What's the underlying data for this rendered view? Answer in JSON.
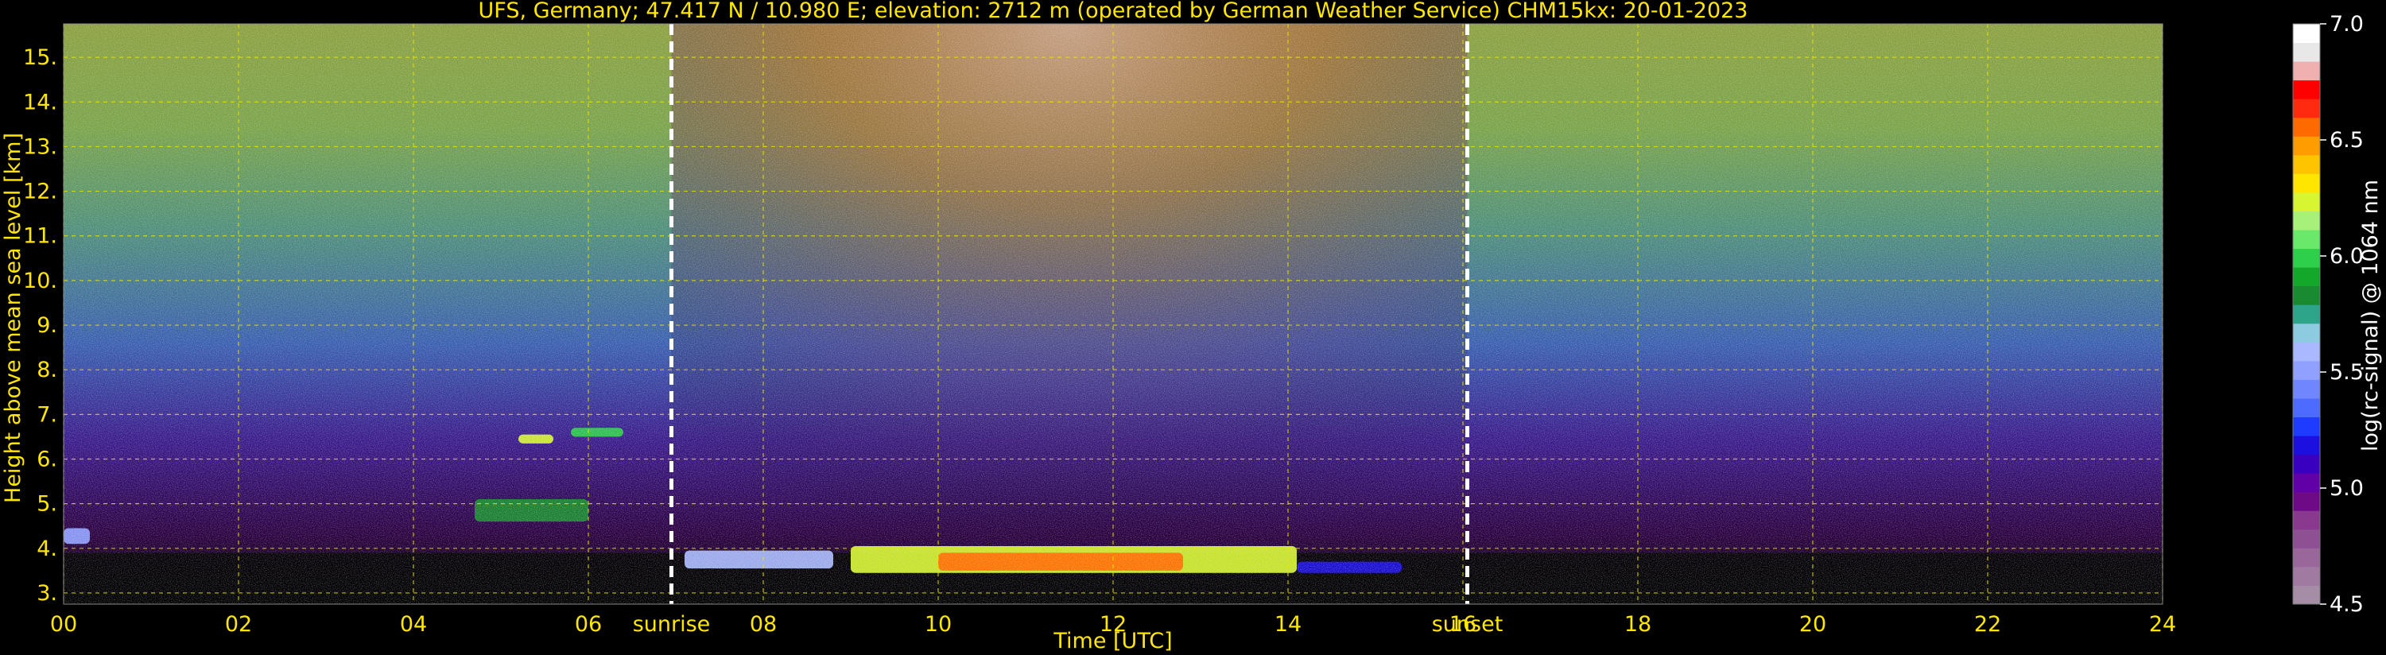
{
  "chart_data": {
    "type": "heatmap",
    "title": "UFS, Germany; 47.417 N / 10.980 E; elevation: 2712 m  (operated by German Weather Service)    CHM15kx: 20-01-2023",
    "xlabel": "Time [UTC]",
    "ylabel": "Height above mean sea level [km]",
    "xlim": [
      0,
      24
    ],
    "ylim": [
      2.75,
      15.75
    ],
    "xticks": [
      "00",
      "02",
      "04",
      "06",
      "08",
      "10",
      "12",
      "14",
      "16",
      "18",
      "20",
      "22",
      "24"
    ],
    "yticks": [
      "3.",
      "4.",
      "5.",
      "6.",
      "7.",
      "8.",
      "9.",
      "10.",
      "11.",
      "12.",
      "13.",
      "14.",
      "15."
    ],
    "grid": true,
    "events": [
      {
        "label": "sunrise",
        "x": 6.95
      },
      {
        "label": "sunset",
        "x": 16.05
      }
    ],
    "colorbar": {
      "label": "log(rc-signal) @ 1064 nm",
      "range": [
        4.5,
        7.0
      ],
      "ticks": [
        "4.5",
        "5.0",
        "5.5",
        "6.0",
        "6.5",
        "7.0"
      ],
      "colors": [
        "#a58ea5",
        "#a17aa1",
        "#9a679a",
        "#8f4f93",
        "#8a3a8e",
        "#6e0a85",
        "#6200a8",
        "#3a00c0",
        "#1c10e0",
        "#1e3cff",
        "#4d6bff",
        "#6f86ff",
        "#8fa0ff",
        "#a9b8ff",
        "#8ccbe0",
        "#2ea58a",
        "#1a8a30",
        "#14a82a",
        "#2ecf4a",
        "#69e86a",
        "#a7f07a",
        "#d7f531",
        "#ffe600",
        "#ffc400",
        "#ff9c00",
        "#ff6a00",
        "#ff2a10",
        "#ff0000",
        "#f0b0b0",
        "#e8e8e8",
        "#ffffff"
      ]
    },
    "cloud_layers": [
      {
        "t_start": 7.1,
        "t_end": 8.8,
        "h_bottom": 3.55,
        "h_top": 3.95,
        "level": 5.6
      },
      {
        "t_start": 9.0,
        "t_end": 14.1,
        "h_bottom": 3.45,
        "h_top": 4.05,
        "level": 6.25
      },
      {
        "t_start": 10.0,
        "t_end": 12.8,
        "h_bottom": 3.5,
        "h_top": 3.9,
        "level": 6.55
      },
      {
        "t_start": 14.1,
        "t_end": 15.3,
        "h_bottom": 3.45,
        "h_top": 3.7,
        "level": 5.2
      },
      {
        "t_start": 4.7,
        "t_end": 6.0,
        "h_bottom": 4.6,
        "h_top": 5.1,
        "level": 5.8
      },
      {
        "t_start": 5.2,
        "t_end": 5.6,
        "h_bottom": 6.35,
        "h_top": 6.55,
        "level": 6.2
      },
      {
        "t_start": 5.8,
        "t_end": 6.4,
        "h_bottom": 6.5,
        "h_top": 6.7,
        "level": 6.0
      },
      {
        "t_start": 0.0,
        "t_end": 0.3,
        "h_bottom": 4.1,
        "h_top": 4.45,
        "level": 5.5
      }
    ]
  }
}
